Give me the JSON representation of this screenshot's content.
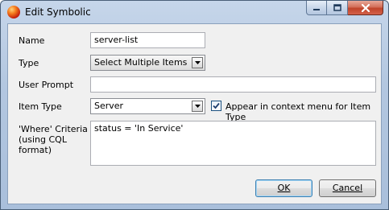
{
  "window": {
    "title": "Edit Symbolic"
  },
  "form": {
    "name_label": "Name",
    "name_value": "server-list",
    "type_label": "Type",
    "type_value": "Select Multiple Items",
    "prompt_label": "User Prompt",
    "prompt_value": "",
    "item_type_label": "Item Type",
    "item_type_value": "Server",
    "context_menu_label": "Appear in context menu for Item Type",
    "context_menu_checked": true,
    "where_label_line1": "'Where' Criteria",
    "where_label_line2": "(using CQL",
    "where_label_line3": "format)",
    "where_value": "status = 'In Service'"
  },
  "buttons": {
    "ok": "OK",
    "cancel": "Cancel"
  },
  "icons": {
    "app": "red-orb-icon",
    "minimize": "minimize-icon",
    "maximize": "maximize-icon",
    "close": "close-icon",
    "dropdown": "chevron-down-icon",
    "check": "checkmark-icon"
  }
}
